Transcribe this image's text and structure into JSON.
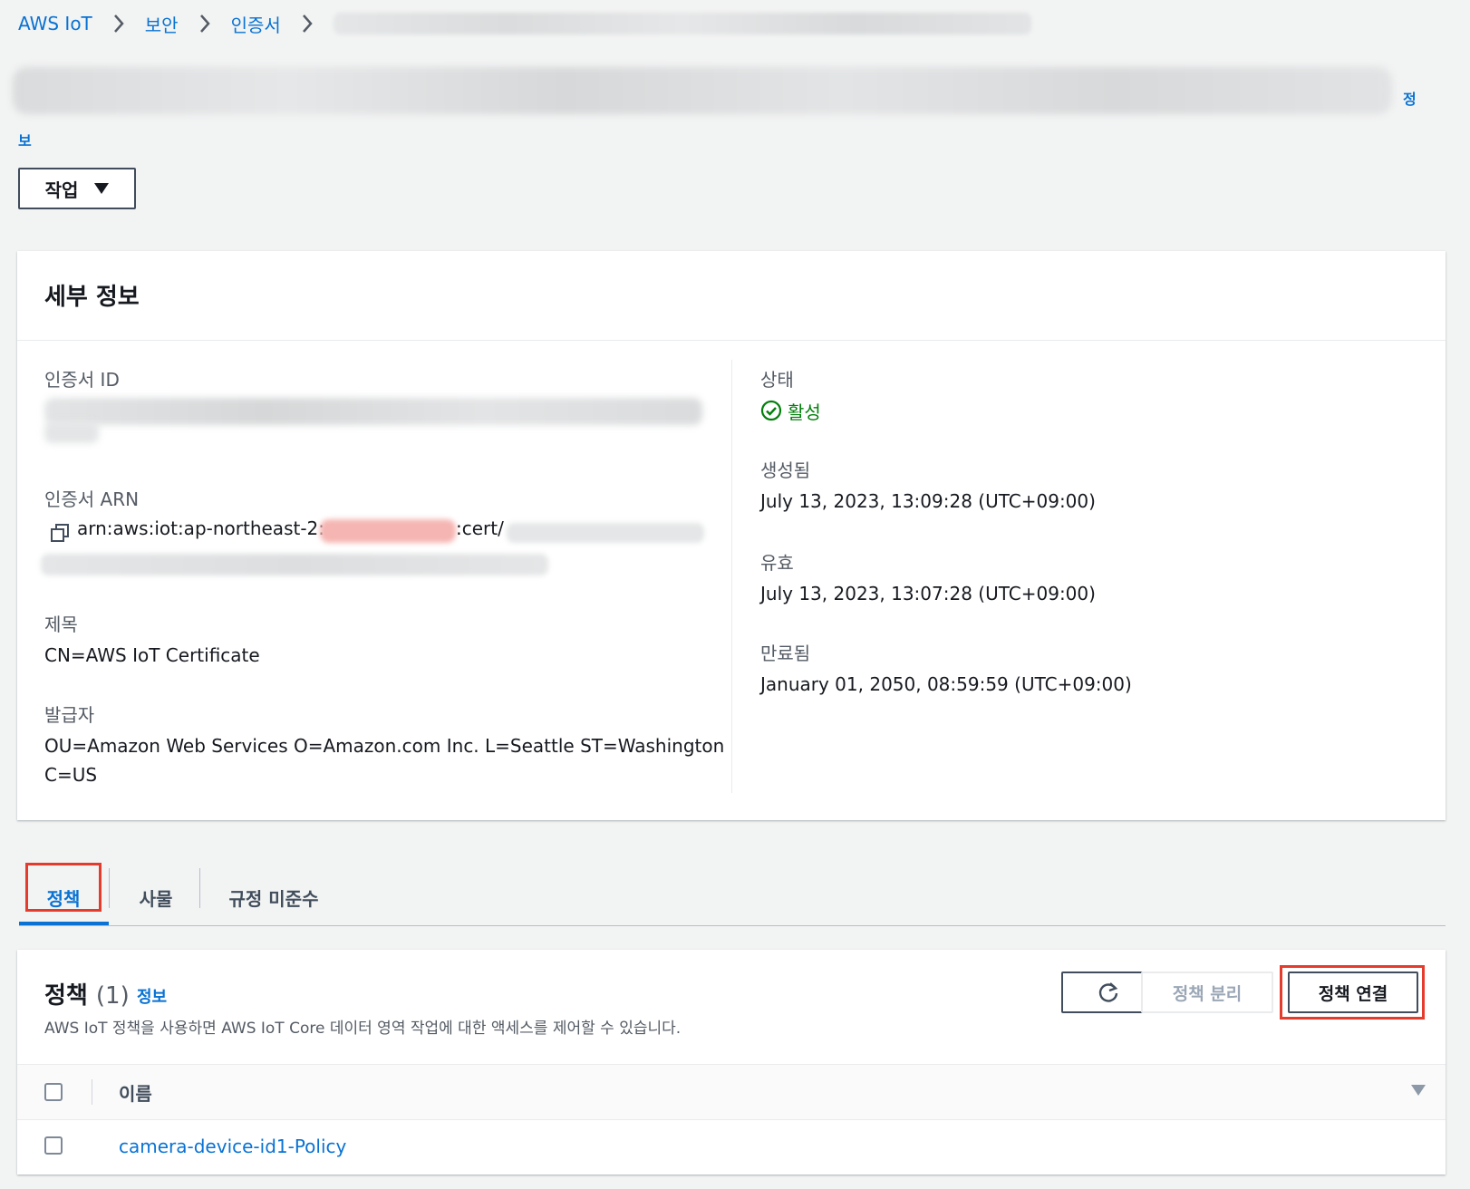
{
  "breadcrumb": {
    "items": [
      "AWS IoT",
      "보안",
      "인증서"
    ]
  },
  "header": {
    "info_link_part1": "정",
    "info_link_part2": "보",
    "actions_label": "작업"
  },
  "details": {
    "title": "세부 정보",
    "cert_id_label": "인증서 ID",
    "cert_arn_label": "인증서 ARN",
    "cert_arn_prefix": "arn:aws:iot:ap-northeast-2:",
    "cert_arn_middle": ":cert/",
    "subject_label": "제목",
    "subject_value": "CN=AWS IoT Certificate",
    "issuer_label": "발급자",
    "issuer_value_line1": "OU=Amazon Web Services O=Amazon.com Inc. L=Seattle ST=Washington",
    "issuer_value_line2": "C=US",
    "status_label": "상태",
    "status_value": "활성",
    "created_label": "생성됨",
    "created_value": "July 13, 2023, 13:09:28 (UTC+09:00)",
    "valid_label": "유효",
    "valid_value": "July 13, 2023, 13:07:28 (UTC+09:00)",
    "expires_label": "만료됨",
    "expires_value": "January 01, 2050, 08:59:59 (UTC+09:00)"
  },
  "tabs": [
    {
      "label": "정책",
      "active": true
    },
    {
      "label": "사물",
      "active": false
    },
    {
      "label": "규정 미준수",
      "active": false
    }
  ],
  "policies": {
    "title": "정책",
    "count": "(1)",
    "info_label": "정보",
    "description": "AWS IoT 정책을 사용하면 AWS IoT Core 데이터 영역 작업에 대한 액세스를 제어할 수 있습니다.",
    "detach_label": "정책 분리",
    "attach_label": "정책 연결",
    "column_name": "이름",
    "rows": [
      {
        "name": "camera-device-id1-Policy"
      }
    ]
  },
  "colors": {
    "link": "#0972d3",
    "success": "#037f0c",
    "highlight": "#e53b2c",
    "redaction": "#f5b5b2"
  },
  "icons": {
    "breadcrumb_separator": "chevron-right-icon",
    "actions_dropdown": "caret-down-icon",
    "status": "check-circle-icon",
    "arn_copy": "copy-icon",
    "refresh": "refresh-icon",
    "sort": "caret-down-icon"
  }
}
